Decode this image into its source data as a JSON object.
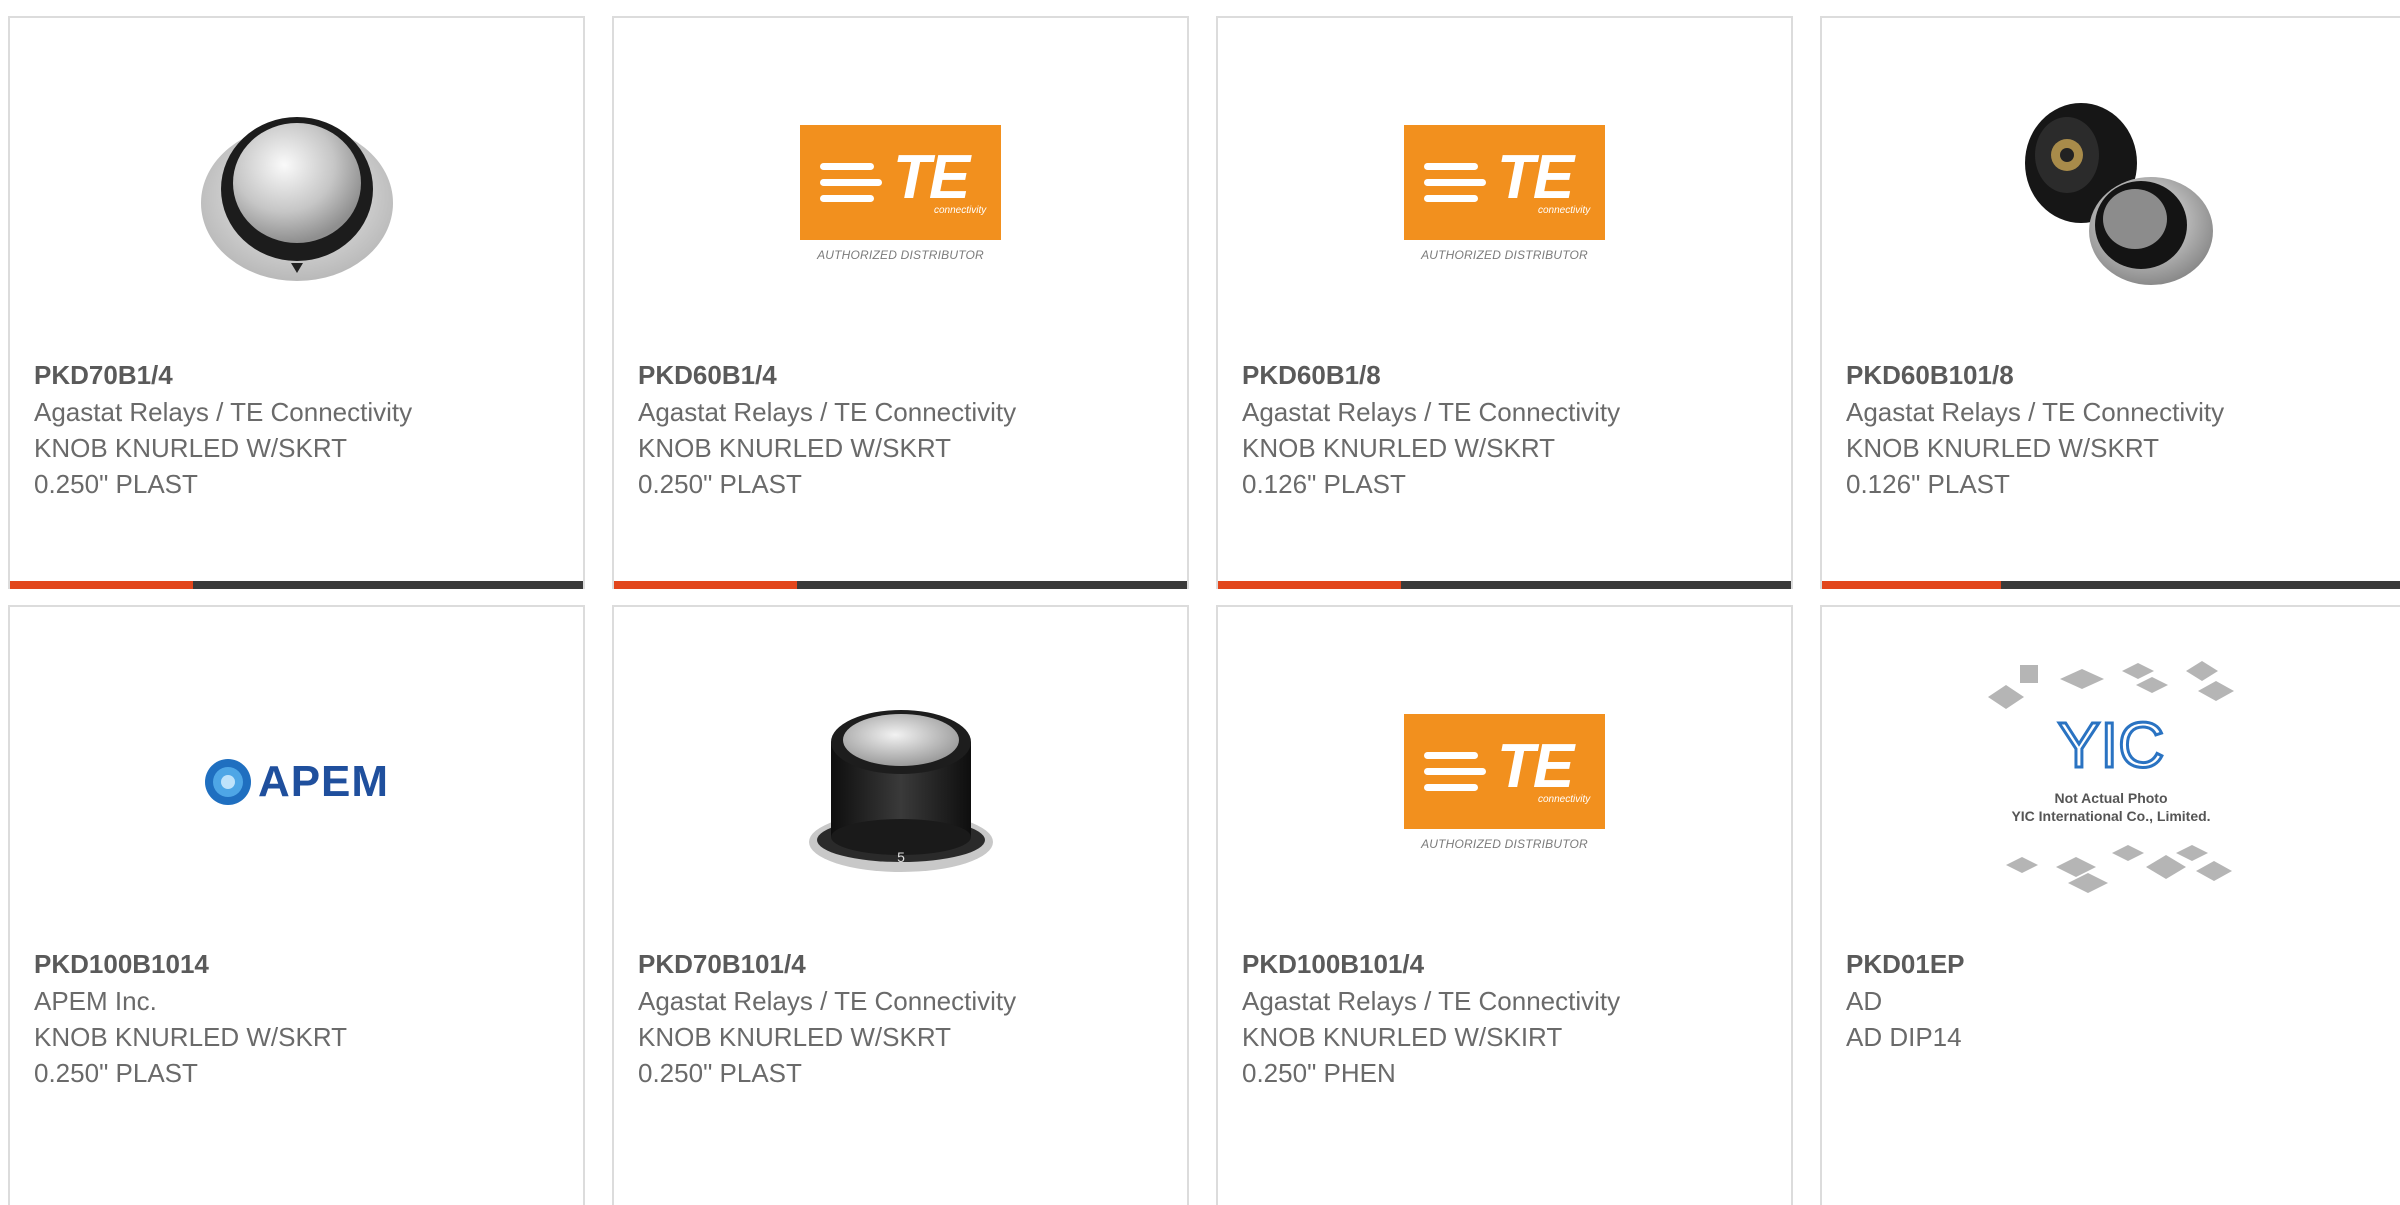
{
  "products": [
    {
      "part": "PKD70B1/4",
      "manufacturer": "Agastat Relays / TE Connectivity",
      "desc1": "KNOB KNURLED W/SKRT",
      "desc2": "0.250\" PLAST",
      "image": "knob-skirt-photo"
    },
    {
      "part": "PKD60B1/4",
      "manufacturer": "Agastat Relays / TE Connectivity",
      "desc1": "KNOB KNURLED W/SKRT",
      "desc2": "0.250\" PLAST",
      "image": "te-connectivity-logo"
    },
    {
      "part": "PKD60B1/8",
      "manufacturer": "Agastat Relays / TE Connectivity",
      "desc1": "KNOB KNURLED W/SKRT",
      "desc2": "0.126\" PLAST",
      "image": "te-connectivity-logo"
    },
    {
      "part": "PKD60B101/8",
      "manufacturer": "Agastat Relays / TE Connectivity",
      "desc1": "KNOB KNURLED W/SKRT",
      "desc2": "0.126\" PLAST",
      "image": "twin-knob-photo"
    },
    {
      "part": "PKD100B1014",
      "manufacturer": "APEM Inc.",
      "desc1": "KNOB KNURLED W/SKRT",
      "desc2": "0.250\" PLAST",
      "image": "apem-logo"
    },
    {
      "part": "PKD70B101/4",
      "manufacturer": "Agastat Relays / TE Connectivity",
      "desc1": "KNOB KNURLED W/SKRT",
      "desc2": "0.250\" PLAST",
      "image": "black-knob-photo"
    },
    {
      "part": "PKD100B101/4",
      "manufacturer": "Agastat Relays / TE Connectivity",
      "desc1": "KNOB KNURLED W/SKIRT",
      "desc2": "0.250\" PHEN",
      "image": "te-connectivity-logo"
    },
    {
      "part": "PKD01EP",
      "manufacturer": "AD",
      "desc1": "AD DIP14",
      "desc2": "",
      "image": "yic-placeholder"
    }
  ],
  "logos": {
    "te_text": "TE",
    "te_sub": "connectivity",
    "te_authorized": "AUTHORIZED DISTRIBUTOR",
    "apem_text": "APEM",
    "yic_text": "YIC",
    "yic_note1": "Not Actual Photo",
    "yic_note2": "YIC International Co., Limited."
  },
  "colors": {
    "accent": "#e2461c",
    "bar": "#3a3a3a",
    "te_orange": "#f2901e",
    "apem_blue": "#1f4f9d"
  }
}
